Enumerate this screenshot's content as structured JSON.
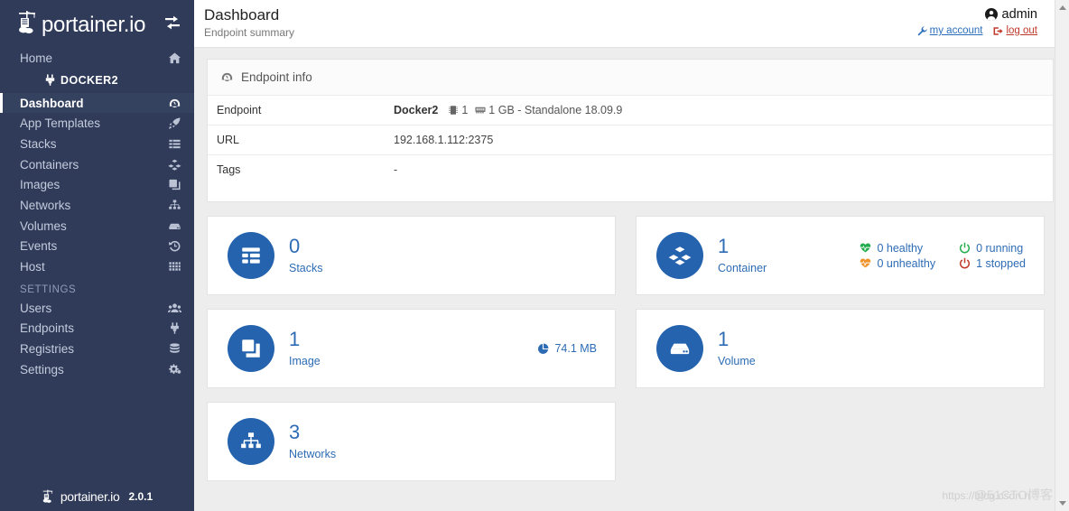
{
  "brand": {
    "name": "portainer.io",
    "version": "2.0.1",
    "toggle_icon": "exchange-arrows-icon"
  },
  "sidebar": {
    "home": {
      "label": "Home",
      "icon": "home-icon"
    },
    "endpoint_chip": {
      "label": "DOCKER2",
      "icon": "plug-icon"
    },
    "items": [
      {
        "label": "Dashboard",
        "icon": "dashboard-icon",
        "active": true
      },
      {
        "label": "App Templates",
        "icon": "rocket-icon",
        "active": false
      },
      {
        "label": "Stacks",
        "icon": "list-icon",
        "active": false
      },
      {
        "label": "Containers",
        "icon": "containers-icon",
        "active": false
      },
      {
        "label": "Images",
        "icon": "images-icon",
        "active": false
      },
      {
        "label": "Networks",
        "icon": "sitemap-icon",
        "active": false
      },
      {
        "label": "Volumes",
        "icon": "hdd-icon",
        "active": false
      },
      {
        "label": "Events",
        "icon": "history-icon",
        "active": false
      },
      {
        "label": "Host",
        "icon": "th-icon",
        "active": false
      }
    ],
    "section_label": "SETTINGS",
    "settings_items": [
      {
        "label": "Users",
        "icon": "users-icon"
      },
      {
        "label": "Endpoints",
        "icon": "plug-icon"
      },
      {
        "label": "Registries",
        "icon": "database-icon"
      },
      {
        "label": "Settings",
        "icon": "cogs-icon"
      }
    ]
  },
  "header": {
    "title": "Dashboard",
    "subtitle": "Endpoint summary",
    "user": {
      "name": "admin",
      "icon": "user-circle-icon"
    },
    "account_link": {
      "label": "my account",
      "icon": "wrench-icon"
    },
    "logout_link": {
      "label": "log out",
      "icon": "sign-out-icon"
    }
  },
  "endpoint_info": {
    "panel_title": "Endpoint info",
    "panel_icon": "tachometer-icon",
    "rows": [
      {
        "key": "Endpoint",
        "type": "endpoint",
        "name": "Docker2",
        "cpu": "1",
        "cpu_icon": "microchip-icon",
        "memory": "1 GB - Standalone 18.09.9",
        "memory_icon": "memory-icon"
      },
      {
        "key": "URL",
        "type": "text",
        "value": "192.168.1.112:2375"
      },
      {
        "key": "Tags",
        "type": "text",
        "value": "-"
      }
    ]
  },
  "cards": [
    {
      "count": "0",
      "label": "Stacks",
      "icon": "stacks-icon",
      "stats": [],
      "size": null
    },
    {
      "count": "1",
      "label": "Container",
      "icon": "containers-icon",
      "stats": [
        {
          "text": "0 healthy",
          "icon": "heartbeat-icon",
          "color": "#23ad4e"
        },
        {
          "text": "0 running",
          "icon": "power-icon",
          "color": "#23ad4e"
        },
        {
          "text": "0 unhealthy",
          "icon": "heartbeat-icon",
          "color": "#f0932b"
        },
        {
          "text": "1 stopped",
          "icon": "power-icon",
          "color": "#c0392b"
        }
      ],
      "size": null
    },
    {
      "count": "1",
      "label": "Image",
      "icon": "images-icon",
      "stats": [],
      "size": {
        "text": "74.1 MB",
        "icon": "pie-chart-icon"
      }
    },
    {
      "count": "1",
      "label": "Volume",
      "icon": "hdd-icon",
      "stats": [],
      "size": null
    },
    {
      "count": "3",
      "label": "Networks",
      "icon": "sitemap-icon",
      "stats": [],
      "size": null
    }
  ],
  "watermark": {
    "text1": "https://blog.csdn.n",
    "text2": "@51CTO博客"
  },
  "colors": {
    "sidebar_bg": "#2f3b59",
    "accent_blue": "#2563ae",
    "text_blue": "#2d6cb5",
    "green": "#23ad4e",
    "orange": "#f0932b",
    "red": "#c0392b"
  }
}
